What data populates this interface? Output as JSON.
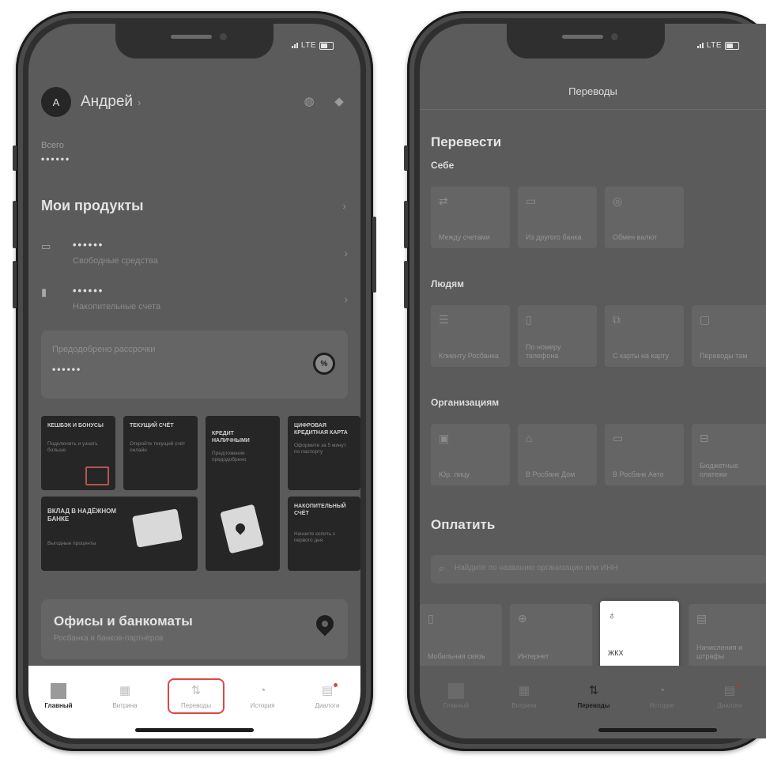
{
  "left_phone": {
    "status": {
      "network": "LTE"
    },
    "header": {
      "avatar_letter": "А",
      "user_name": "Андрей",
      "chevron": "›"
    },
    "total": {
      "label": "Всего",
      "value": "••••••"
    },
    "products": {
      "title": "Мои продукты",
      "items": [
        {
          "icon": "card-icon",
          "value": "••••••",
          "subtitle": "Свободные средства"
        },
        {
          "icon": "chart-icon",
          "value": "••••••",
          "subtitle": "Накопительные счета"
        }
      ]
    },
    "preapproved": {
      "label": "Предодобрено рассрочки",
      "value": "••••••",
      "ring_glyph": "%"
    },
    "promos": [
      {
        "title": "Кешбэк и бонусы",
        "subtitle": "Подключить и узнать больше"
      },
      {
        "title": "Текущий счёт",
        "subtitle": "Откройте текущий счёт онлайн"
      },
      {
        "title": "Кредит наличными",
        "subtitle": "Предложение предодобрено"
      },
      {
        "title": "Цифровая кредитная карта",
        "subtitle": "Оформите за 5 минут по паспорту"
      },
      {
        "title": "Вклад в надёжном банке",
        "subtitle": "Выгодные проценты"
      },
      {
        "title": "Накопительный счёт",
        "subtitle": "Начните копить с первого дня"
      }
    ],
    "offices": {
      "title": "Офисы и банкоматы",
      "subtitle": "Росбанка и банков-партнёров"
    },
    "tabbar": [
      {
        "label": "Главный",
        "icon": "home-icon"
      },
      {
        "label": "Витрина",
        "icon": "grid-icon"
      },
      {
        "label": "Переводы",
        "icon": "transfer-icon"
      },
      {
        "label": "История",
        "icon": "clock-icon"
      },
      {
        "label": "Диалоги",
        "icon": "chat-icon"
      }
    ]
  },
  "right_phone": {
    "status": {
      "network": "LTE"
    },
    "title": "Переводы",
    "transfer_title": "Перевести",
    "self": {
      "title": "Себе",
      "tiles": [
        {
          "icon": "swap-icon",
          "label": "Между счетами"
        },
        {
          "icon": "bank-card-icon",
          "label": "Из другого банка"
        },
        {
          "icon": "currency-exchange-icon",
          "label": "Обмен валют"
        }
      ]
    },
    "people": {
      "title": "Людям",
      "tiles": [
        {
          "icon": "person-card-icon",
          "label": "Клиенту Росбанка"
        },
        {
          "icon": "phone-icon",
          "label": "По номеру телефона"
        },
        {
          "icon": "card-to-card-icon",
          "label": "С карты на карту"
        },
        {
          "icon": "document-icon",
          "label": "Переводы там"
        }
      ]
    },
    "organizations": {
      "title": "Организациям",
      "tiles": [
        {
          "icon": "legal-entity-icon",
          "label": "Юр. лицу"
        },
        {
          "icon": "house-icon",
          "label": "В Росбанк Дом"
        },
        {
          "icon": "car-icon",
          "label": "В Росбанк Авто"
        },
        {
          "icon": "budget-icon",
          "label": "Бюджетные платежи"
        }
      ]
    },
    "pay": {
      "title": "Оплатить",
      "search_placeholder": "Найдите по названию организации или ИНН",
      "tiles": [
        {
          "icon": "mobile-icon",
          "label": "Мобильная связь"
        },
        {
          "icon": "globe-icon",
          "label": "Интернет"
        },
        {
          "icon": "utility-icon",
          "label": "ЖКХ"
        },
        {
          "icon": "receipt-icon",
          "label": "Начисления и штрафы"
        }
      ]
    },
    "tabbar": [
      {
        "label": "Главный",
        "icon": "home-icon"
      },
      {
        "label": "Витрина",
        "icon": "grid-icon"
      },
      {
        "label": "Переводы",
        "icon": "transfer-icon"
      },
      {
        "label": "История",
        "icon": "clock-icon"
      },
      {
        "label": "Диалоги",
        "icon": "chat-icon"
      }
    ]
  },
  "colors": {
    "highlight": "#e0463f",
    "dim": "#5b5b5c",
    "card": "#656566",
    "dark": "#262626"
  }
}
